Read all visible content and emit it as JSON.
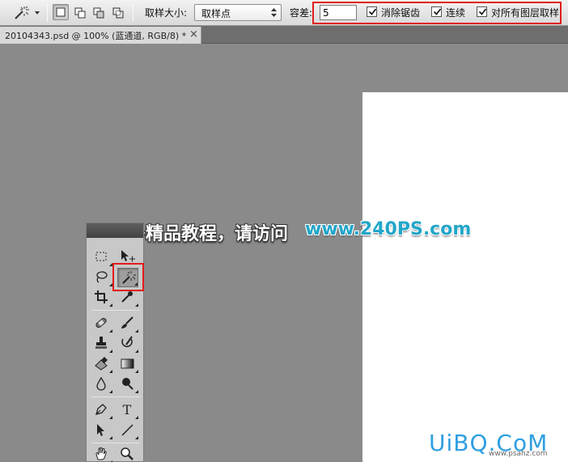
{
  "options_bar": {
    "sample_size_label": "取样大小:",
    "sample_size_value": "取样点",
    "tolerance_label": "容差:",
    "tolerance_value": "5",
    "anti_alias_label": "消除锯齿",
    "anti_alias_checked": true,
    "contiguous_label": "连续",
    "contiguous_checked": true,
    "sample_all_layers_label": "对所有图层取样",
    "sample_all_layers_checked": true,
    "selection_modes": [
      "new-selection",
      "add-to-selection",
      "subtract-from-selection",
      "intersect-with-selection"
    ],
    "active_mode": "new-selection"
  },
  "document_tab": {
    "title": "20104343.psd @ 100% (蓝通道, RGB/8) *",
    "close_glyph": "×"
  },
  "watermark": {
    "text": "更多精品教程，请访问",
    "url": "www.240PS.com"
  },
  "toolbox": {
    "tools": [
      {
        "name": "rectangular-marquee",
        "selected": false
      },
      {
        "name": "move",
        "selected": false
      },
      {
        "name": "lasso",
        "selected": false
      },
      {
        "name": "magic-wand",
        "selected": true
      },
      {
        "name": "crop",
        "selected": false
      },
      {
        "name": "eyedropper",
        "selected": false
      },
      {
        "name": "spot-healing-brush",
        "selected": false
      },
      {
        "name": "brush",
        "selected": false
      },
      {
        "name": "clone-stamp",
        "selected": false
      },
      {
        "name": "history-brush",
        "selected": false
      },
      {
        "name": "eraser",
        "selected": false
      },
      {
        "name": "gradient",
        "selected": false
      },
      {
        "name": "blur",
        "selected": false
      },
      {
        "name": "dodge",
        "selected": false
      },
      {
        "name": "pen",
        "selected": false
      },
      {
        "name": "horizontal-type",
        "selected": false
      },
      {
        "name": "path-selection",
        "selected": false
      },
      {
        "name": "line",
        "selected": false
      },
      {
        "name": "hand",
        "selected": false
      },
      {
        "name": "zoom",
        "selected": false
      }
    ],
    "type_tool_glyph": "T"
  },
  "logo": {
    "text": "UiBQ.CoM",
    "sub": "www.psahz.com"
  },
  "colors": {
    "workspace": "#8a8a8a",
    "highlight_red": "#e21b1b",
    "url_blue": "#22a6c9"
  }
}
